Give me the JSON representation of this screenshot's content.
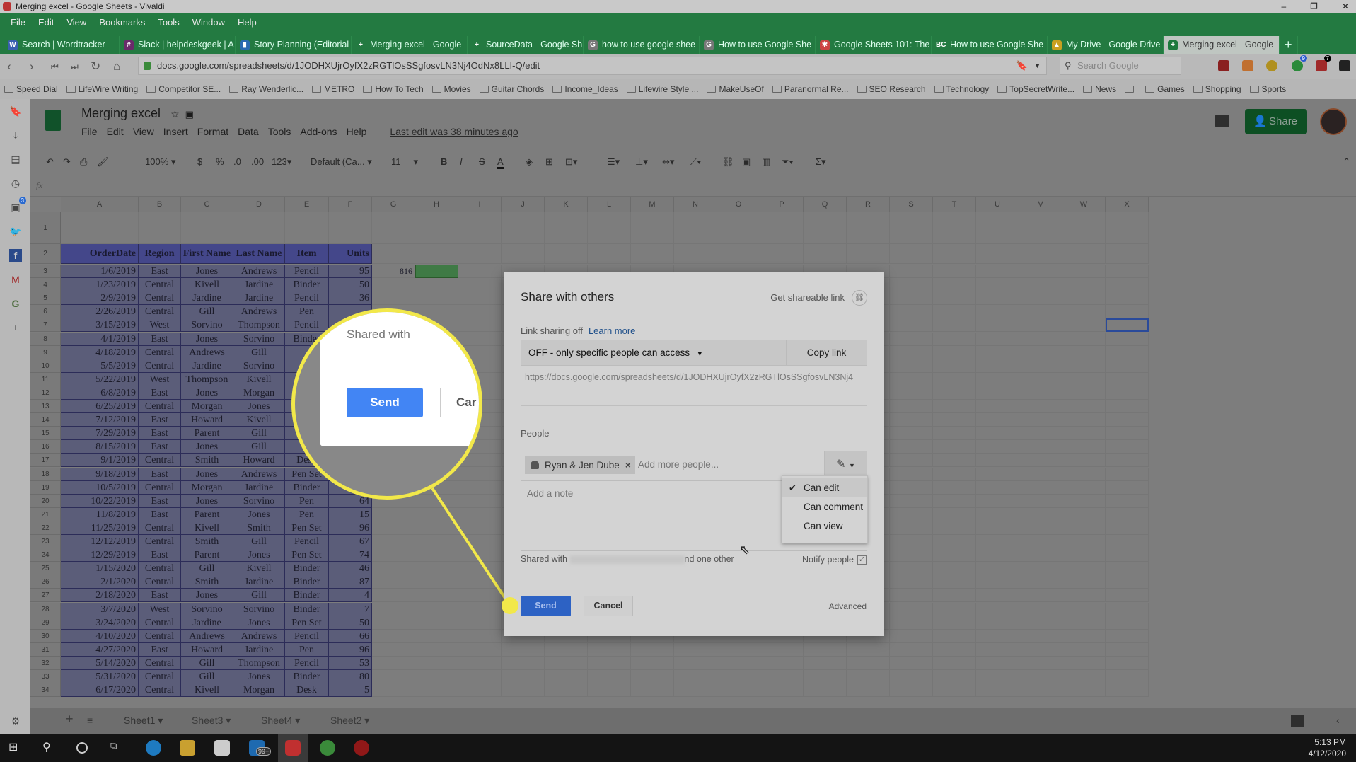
{
  "window": {
    "title": "Merging excel - Google Sheets - Vivaldi",
    "menu": [
      "File",
      "Edit",
      "View",
      "Bookmarks",
      "Tools",
      "Window",
      "Help"
    ]
  },
  "tabs": [
    {
      "label": "Search | Wordtracker",
      "icon": "W",
      "color": "#3a5fb0"
    },
    {
      "label": "Slack | helpdeskgeek | A",
      "icon": "#",
      "color": "#6a2a6a"
    },
    {
      "label": "Story Planning (Editorial",
      "icon": "▮",
      "color": "#2a6ab0"
    },
    {
      "label": "Merging excel - Google",
      "icon": "+",
      "color": "#237a41"
    },
    {
      "label": "SourceData - Google Sh",
      "icon": "+",
      "color": "#237a41"
    },
    {
      "label": "how to use google shee",
      "icon": "G",
      "color": "#777"
    },
    {
      "label": "How to use Google She",
      "icon": "G",
      "color": "#777"
    },
    {
      "label": "Google Sheets 101: The",
      "icon": "✱",
      "color": "#c44"
    },
    {
      "label": "How to use Google She",
      "icon": "BC",
      "color": "#237a41"
    },
    {
      "label": "My Drive - Google Drive",
      "icon": "▲",
      "color": "#c9a020"
    },
    {
      "label": "Merging excel - Google",
      "icon": "+",
      "color": "#1e7a3e",
      "active": true
    }
  ],
  "address": {
    "url": "docs.google.com/spreadsheets/d/1JODHXUjrOyfX2zRGTlOsSSgfosvLN3Nj4OdNx8LLI-Q/edit",
    "search_placeholder": "Search Google",
    "badges": [
      "9",
      "7"
    ]
  },
  "bookmarks": [
    "Speed Dial",
    "LifeWire Writing",
    "Competitor SE...",
    "Ray Wenderlic...",
    "METRO",
    "How To Tech",
    "Movies",
    "Guitar Chords",
    "Income_Ideas",
    "Lifewire Style ...",
    "MakeUseOf",
    "Paranormal Re...",
    "SEO Research",
    "Technology",
    "TopSecretWrite...",
    "News",
    "",
    "Games",
    "Shopping",
    "Sports"
  ],
  "sidepanel": {
    "badge": "3"
  },
  "doc": {
    "title": "Merging excel",
    "menu": [
      "File",
      "Edit",
      "View",
      "Insert",
      "Format",
      "Data",
      "Tools",
      "Add-ons",
      "Help"
    ],
    "last_edit": "Last edit was 38 minutes ago",
    "share_label": "Share",
    "toolbar": {
      "zoom": "100%",
      "currency": "$",
      "percent": "%",
      "dec_less": ".0",
      "dec_more": ".00",
      "format": "123",
      "font": "Default (Ca...",
      "size": "11",
      "bold": "B",
      "italic": "I",
      "strike": "S",
      "color": "A"
    },
    "fx": "fx"
  },
  "sheet": {
    "columns": [
      "A",
      "B",
      "C",
      "D",
      "E",
      "F",
      "G",
      "H",
      "I",
      "J",
      "K",
      "L",
      "M",
      "N",
      "O",
      "P",
      "Q",
      "R",
      "S",
      "T",
      "U",
      "V",
      "W",
      "X"
    ],
    "headers": [
      "OrderDate",
      "Region",
      "First Name",
      "Last Name",
      "Item",
      "Units"
    ],
    "rows": [
      [
        "1/6/2019",
        "East",
        "Jones",
        "Andrews",
        "Pencil",
        "95"
      ],
      [
        "1/23/2019",
        "Central",
        "Kivell",
        "Jardine",
        "Binder",
        "50"
      ],
      [
        "2/9/2019",
        "Central",
        "Jardine",
        "Jardine",
        "Pencil",
        "36"
      ],
      [
        "2/26/2019",
        "Central",
        "Gill",
        "Andrews",
        "Pen",
        ""
      ],
      [
        "3/15/2019",
        "West",
        "Sorvino",
        "Thompson",
        "Pencil",
        ""
      ],
      [
        "4/1/2019",
        "East",
        "Jones",
        "Sorvino",
        "Binder",
        ""
      ],
      [
        "4/18/2019",
        "Central",
        "Andrews",
        "Gill",
        "",
        ""
      ],
      [
        "5/5/2019",
        "Central",
        "Jardine",
        "Sorvino",
        "",
        ""
      ],
      [
        "5/22/2019",
        "West",
        "Thompson",
        "Kivell",
        "",
        ""
      ],
      [
        "6/8/2019",
        "East",
        "Jones",
        "Morgan",
        "",
        ""
      ],
      [
        "6/25/2019",
        "Central",
        "Morgan",
        "Jones",
        "",
        ""
      ],
      [
        "7/12/2019",
        "East",
        "Howard",
        "Kivell",
        "",
        ""
      ],
      [
        "7/29/2019",
        "East",
        "Parent",
        "Gill",
        "",
        ""
      ],
      [
        "8/15/2019",
        "East",
        "Jones",
        "Gill",
        "",
        ""
      ],
      [
        "9/1/2019",
        "Central",
        "Smith",
        "Howard",
        "Desk",
        ""
      ],
      [
        "9/18/2019",
        "East",
        "Jones",
        "Andrews",
        "Pen Set",
        ""
      ],
      [
        "10/5/2019",
        "Central",
        "Morgan",
        "Jardine",
        "Binder",
        ""
      ],
      [
        "10/22/2019",
        "East",
        "Jones",
        "Sorvino",
        "Pen",
        "64"
      ],
      [
        "11/8/2019",
        "East",
        "Parent",
        "Jones",
        "Pen",
        "15"
      ],
      [
        "11/25/2019",
        "Central",
        "Kivell",
        "Smith",
        "Pen Set",
        "96"
      ],
      [
        "12/12/2019",
        "Central",
        "Smith",
        "Gill",
        "Pencil",
        "67"
      ],
      [
        "12/29/2019",
        "East",
        "Parent",
        "Jones",
        "Pen Set",
        "74"
      ],
      [
        "1/15/2020",
        "Central",
        "Gill",
        "Kivell",
        "Binder",
        "46"
      ],
      [
        "2/1/2020",
        "Central",
        "Smith",
        "Jardine",
        "Binder",
        "87"
      ],
      [
        "2/18/2020",
        "East",
        "Jones",
        "Gill",
        "Binder",
        "4"
      ],
      [
        "3/7/2020",
        "West",
        "Sorvino",
        "Sorvino",
        "Binder",
        "7"
      ],
      [
        "3/24/2020",
        "Central",
        "Jardine",
        "Jones",
        "Pen Set",
        "50"
      ],
      [
        "4/10/2020",
        "Central",
        "Andrews",
        "Andrews",
        "Pencil",
        "66"
      ],
      [
        "4/27/2020",
        "East",
        "Howard",
        "Jardine",
        "Pen",
        "96"
      ],
      [
        "5/14/2020",
        "Central",
        "Gill",
        "Thompson",
        "Pencil",
        "53"
      ],
      [
        "5/31/2020",
        "Central",
        "Gill",
        "Jones",
        "Binder",
        "80"
      ],
      [
        "6/17/2020",
        "Central",
        "Kivell",
        "Morgan",
        "Desk",
        "5"
      ]
    ],
    "g3": "816",
    "tabs": [
      "Sheet1",
      "Sheet3",
      "Sheet4",
      "Sheet2"
    ]
  },
  "dialog": {
    "title": "Share with others",
    "get_link": "Get shareable link",
    "link_status": "Link sharing off",
    "learn_more": "Learn more",
    "access": "OFF - only specific people can access",
    "copy_link": "Copy link",
    "link_url": "https://docs.google.com/spreadsheets/d/1JODHXUjrOyfX2zRGTlOsSSgfosvLN3Nj4",
    "people_label": "People",
    "person": "Ryan & Jen Dube",
    "add_placeholder": "Add more people...",
    "note_placeholder": "Add a note",
    "permissions": [
      "Can edit",
      "Can comment",
      "Can view"
    ],
    "selected_permission": "Can edit",
    "shared_with_prefix": "Shared with",
    "shared_with_suffix": "nd one other",
    "notify": "Notify people",
    "notify_checked": true,
    "send": "Send",
    "cancel": "Cancel",
    "advanced": "Advanced"
  },
  "magnifier": {
    "shared_with": "Shared with",
    "send": "Send",
    "cancel": "Car"
  },
  "highlight_color": "#f2e84a",
  "taskbar": {
    "time": "5:13 PM",
    "date": "4/12/2020",
    "mail_badge": "99+"
  }
}
